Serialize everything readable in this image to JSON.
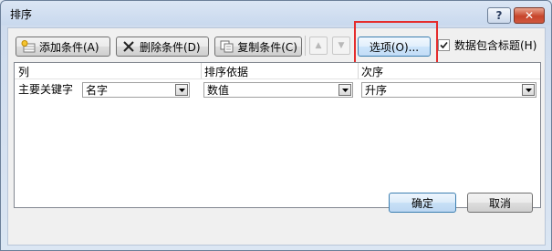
{
  "window": {
    "title": "排序"
  },
  "titlebar": {
    "help_glyph": "?",
    "close_glyph": "✕"
  },
  "toolbar": {
    "add_condition": "添加条件(A)",
    "delete_condition": "删除条件(D)",
    "copy_condition": "复制条件(C)",
    "options": "选项(O)...",
    "header_checkbox_label": "数据包含标题(H)",
    "header_checkbox_checked": true
  },
  "grid": {
    "columns": [
      "列",
      "排序依据",
      "次序"
    ],
    "rows": [
      {
        "label": "主要关键字",
        "column_value": "名字",
        "sort_on_value": "数值",
        "order_value": "升序"
      }
    ]
  },
  "footer": {
    "ok_label": "确定",
    "cancel_label": "取消"
  },
  "colors": {
    "highlight": "#e52c2c",
    "close_button": "#c7452b"
  }
}
